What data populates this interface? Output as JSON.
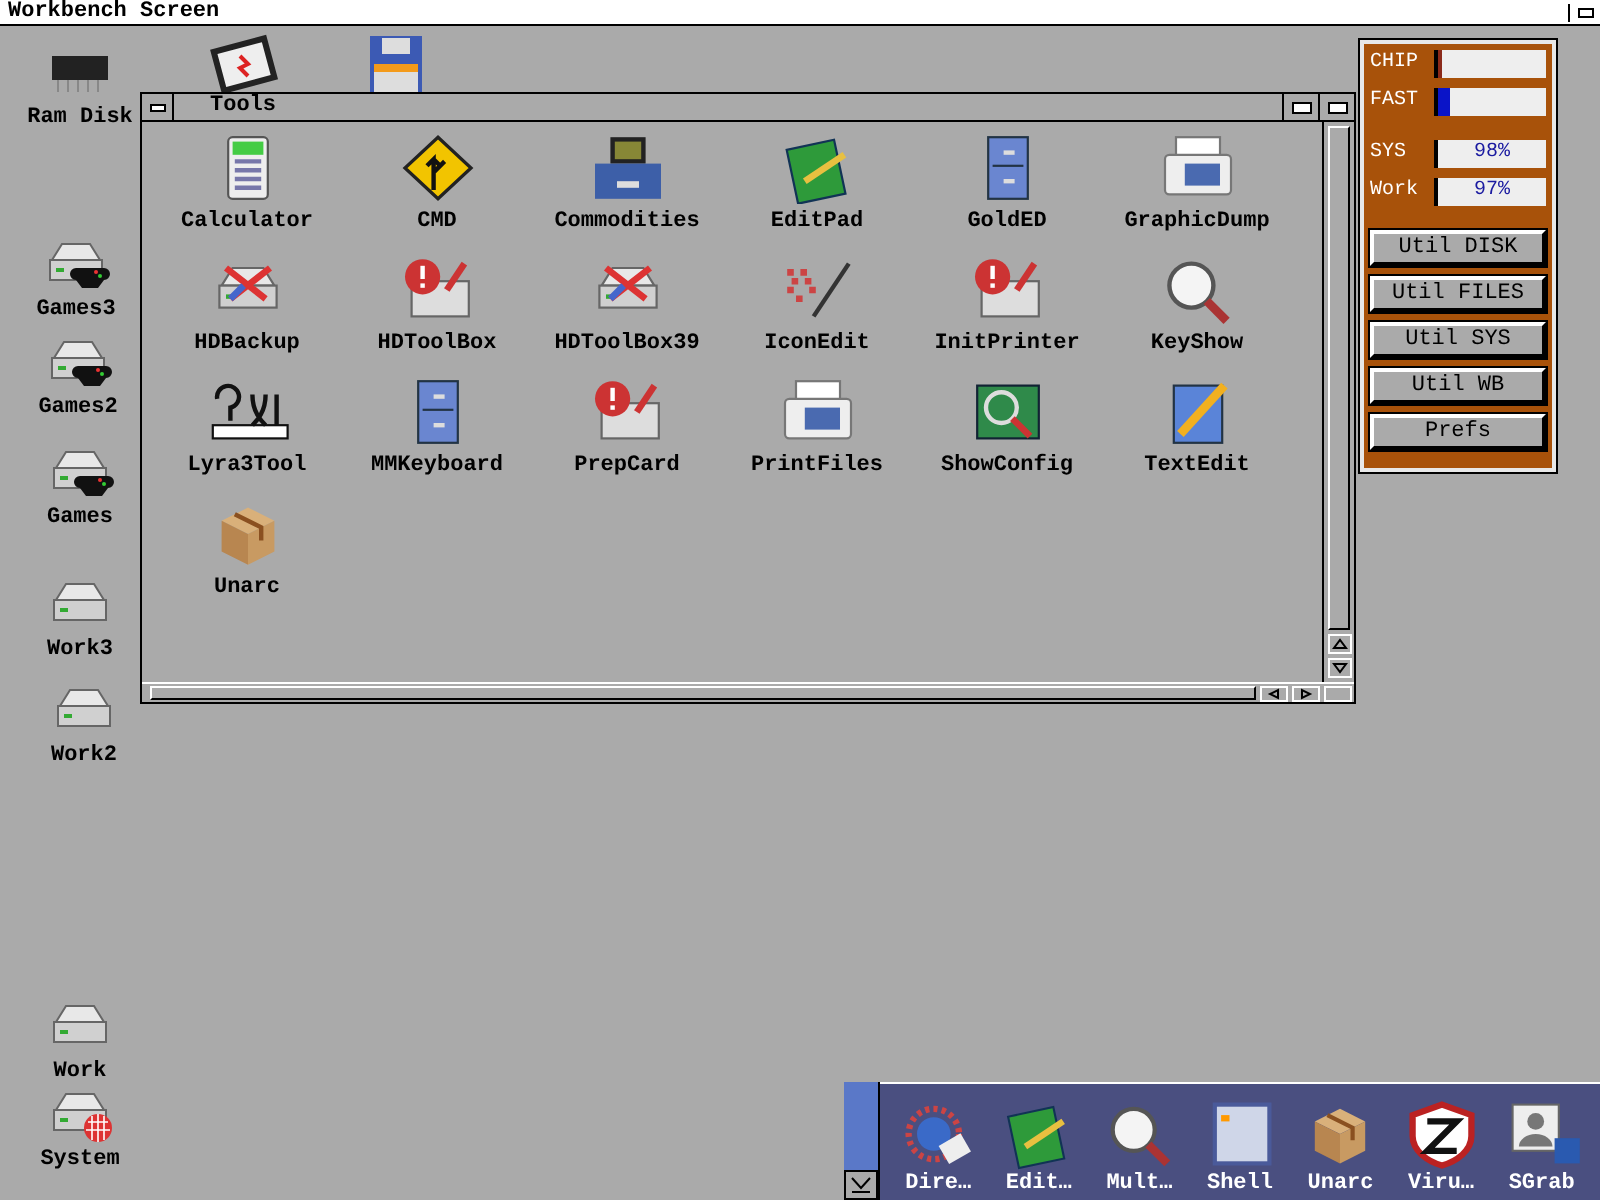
{
  "screen_title": "Workbench Screen",
  "desktop_icons": [
    {
      "label": "Ram Disk",
      "kind": "memory"
    },
    {
      "kind": "chip"
    },
    {
      "kind": "floppy"
    },
    {
      "label": "Games3",
      "kind": "gamepad"
    },
    {
      "label": "Games2",
      "kind": "gamepad"
    },
    {
      "label": "Games",
      "kind": "gamepad"
    },
    {
      "label": "Work3",
      "kind": "drive"
    },
    {
      "label": "Work2",
      "kind": "drive"
    },
    {
      "label": "Work",
      "kind": "drive"
    },
    {
      "label": "System",
      "kind": "ball"
    }
  ],
  "window": {
    "title": "Tools",
    "icons": [
      {
        "label": "Calculator",
        "kind": "calculator"
      },
      {
        "label": "CMD",
        "kind": "sign"
      },
      {
        "label": "Commodities",
        "kind": "drawer"
      },
      {
        "label": "EditPad",
        "kind": "notepad"
      },
      {
        "label": "GoldED",
        "kind": "cabinet"
      },
      {
        "label": "GraphicDump",
        "kind": "printer"
      },
      {
        "label": "HDBackup",
        "kind": "tools"
      },
      {
        "label": "HDToolBox",
        "kind": "alert"
      },
      {
        "label": "HDToolBox39",
        "kind": "tools"
      },
      {
        "label": "IconEdit",
        "kind": "pixels"
      },
      {
        "label": "InitPrinter",
        "kind": "alert"
      },
      {
        "label": "KeyShow",
        "kind": "magnifier"
      },
      {
        "label": "Lyra3Tool",
        "kind": "harp"
      },
      {
        "label": "MMKeyboard",
        "kind": "cabinet"
      },
      {
        "label": "PrepCard",
        "kind": "alert"
      },
      {
        "label": "PrintFiles",
        "kind": "printer"
      },
      {
        "label": "ShowConfig",
        "kind": "board"
      },
      {
        "label": "TextEdit",
        "kind": "pencil"
      },
      {
        "label": "Unarc",
        "kind": "box"
      }
    ]
  },
  "monitor": {
    "gauges": [
      {
        "label": "CHIP",
        "level": 0.03,
        "color": "#8b2a1a"
      },
      {
        "label": "FAST",
        "level": 0.12,
        "color": "#0a14c8"
      }
    ],
    "drives": [
      {
        "label": "SYS",
        "reading": "98%"
      },
      {
        "label": "Work",
        "reading": "97%"
      }
    ],
    "buttons": [
      "Util DISK",
      "Util FILES",
      "Util SYS",
      "Util WB",
      "Prefs"
    ]
  },
  "dock": {
    "items": [
      {
        "label": "Dire…",
        "kind": "dial"
      },
      {
        "label": "Edit…",
        "kind": "notepad"
      },
      {
        "label": "Mult…",
        "kind": "magnifier"
      },
      {
        "label": "Shell",
        "kind": "shell"
      },
      {
        "label": "Unarc",
        "kind": "box"
      },
      {
        "label": "Viru…",
        "kind": "shield"
      },
      {
        "label": "SGrab",
        "kind": "portrait"
      }
    ]
  }
}
